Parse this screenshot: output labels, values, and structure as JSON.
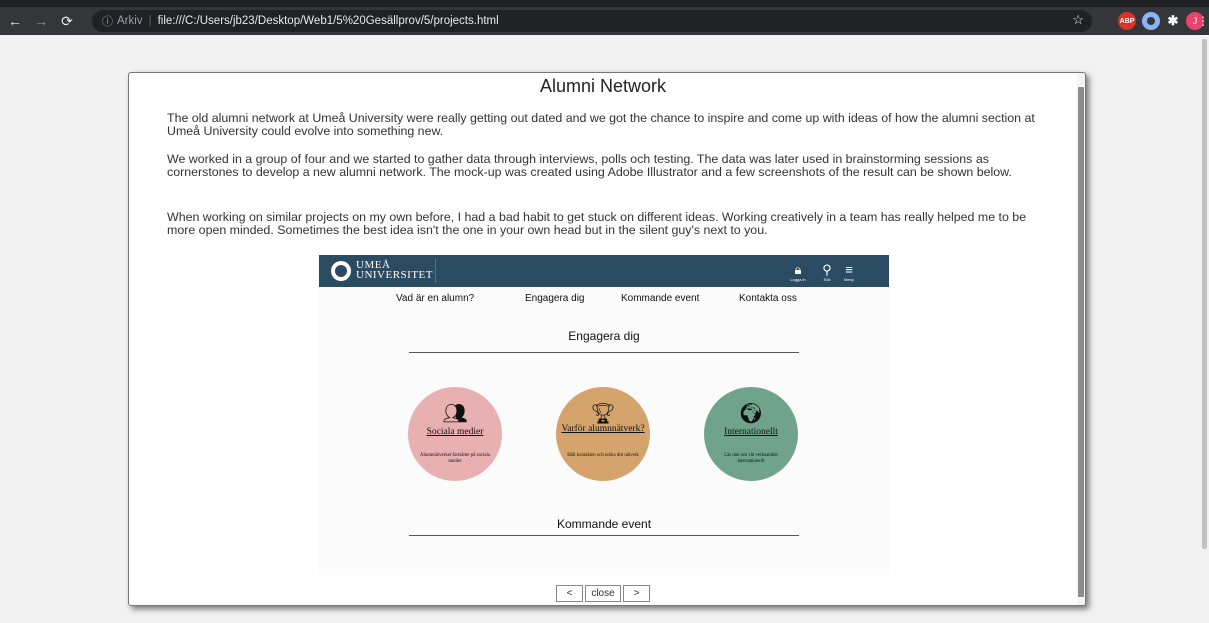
{
  "browser": {
    "url_prefix": "Arkiv",
    "url": "file:///C:/Users/jb23/Desktop/Web1/5%20Gesällprov/5/projects.html",
    "profile_initial": "J",
    "adblock_label": "ABP"
  },
  "modal": {
    "title": "Alumni Network",
    "paragraphs": [
      "The old alumni network at Umeå University were really getting out dated and we got the chance to inspire and come up with ideas of how the alumni section at Umeå University could evolve into something new.",
      "We worked in a group of four and we started to gather data through interviews, polls och testing. The data was later used in brainstorming sessions as cornerstones to develop a new alumni network. The mock-up was created using Adobe Illustrator and a few screenshots of the result can be shown below.",
      "When working on similar projects on my own before, I had a bad habit to get stuck on different ideas. Working creatively in a team has really helped me to be more open minded. Sometimes the best idea isn't the one in your own head but in the silent guy's next to you."
    ],
    "buttons": {
      "prev": "<",
      "close": "close",
      "next": ">"
    }
  },
  "mockup": {
    "logo_line1": "UMEÅ",
    "logo_line2": "UNIVERSITET",
    "header_icons": [
      {
        "icon": "lock-icon",
        "label": "Logga in"
      },
      {
        "icon": "search-icon",
        "label": "Sök"
      },
      {
        "icon": "menu-icon",
        "label": "Meny"
      }
    ],
    "nav": [
      "Vad är en alumn?",
      "Engagera dig",
      "Kommande event",
      "Kontakta oss"
    ],
    "section1_title": "Engagera dig",
    "section2_title": "Kommande event",
    "circles": [
      {
        "title": "Sociala medier",
        "subtitle": "Alumnnätverket fortsätter på sociala medier",
        "color": "#e9b0b2",
        "icon": "people-icon"
      },
      {
        "title": "Varför alumnnätverk?",
        "subtitle": "Håll kontakten och utöka ditt nätverk",
        "color": "#d4a46c",
        "icon": "trophy-icon"
      },
      {
        "title": "Internationellt",
        "subtitle": "Läs mer om vår verksamhet internationellt",
        "color": "#6fa38b",
        "icon": "globe-icon"
      }
    ]
  }
}
